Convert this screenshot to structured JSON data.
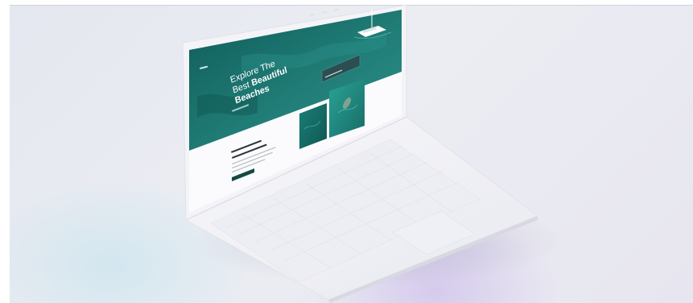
{
  "screen": {
    "hero_line_1": "Explore The",
    "hero_line_2a": "Best ",
    "hero_line_2b": "Beautiful",
    "hero_line_3": "Beaches"
  },
  "colors": {
    "hero_teal": "#1b6d69",
    "hero_teal_light": "#2a8b84",
    "laptop_white": "#f3f3f7",
    "button_dark": "#164a45"
  }
}
